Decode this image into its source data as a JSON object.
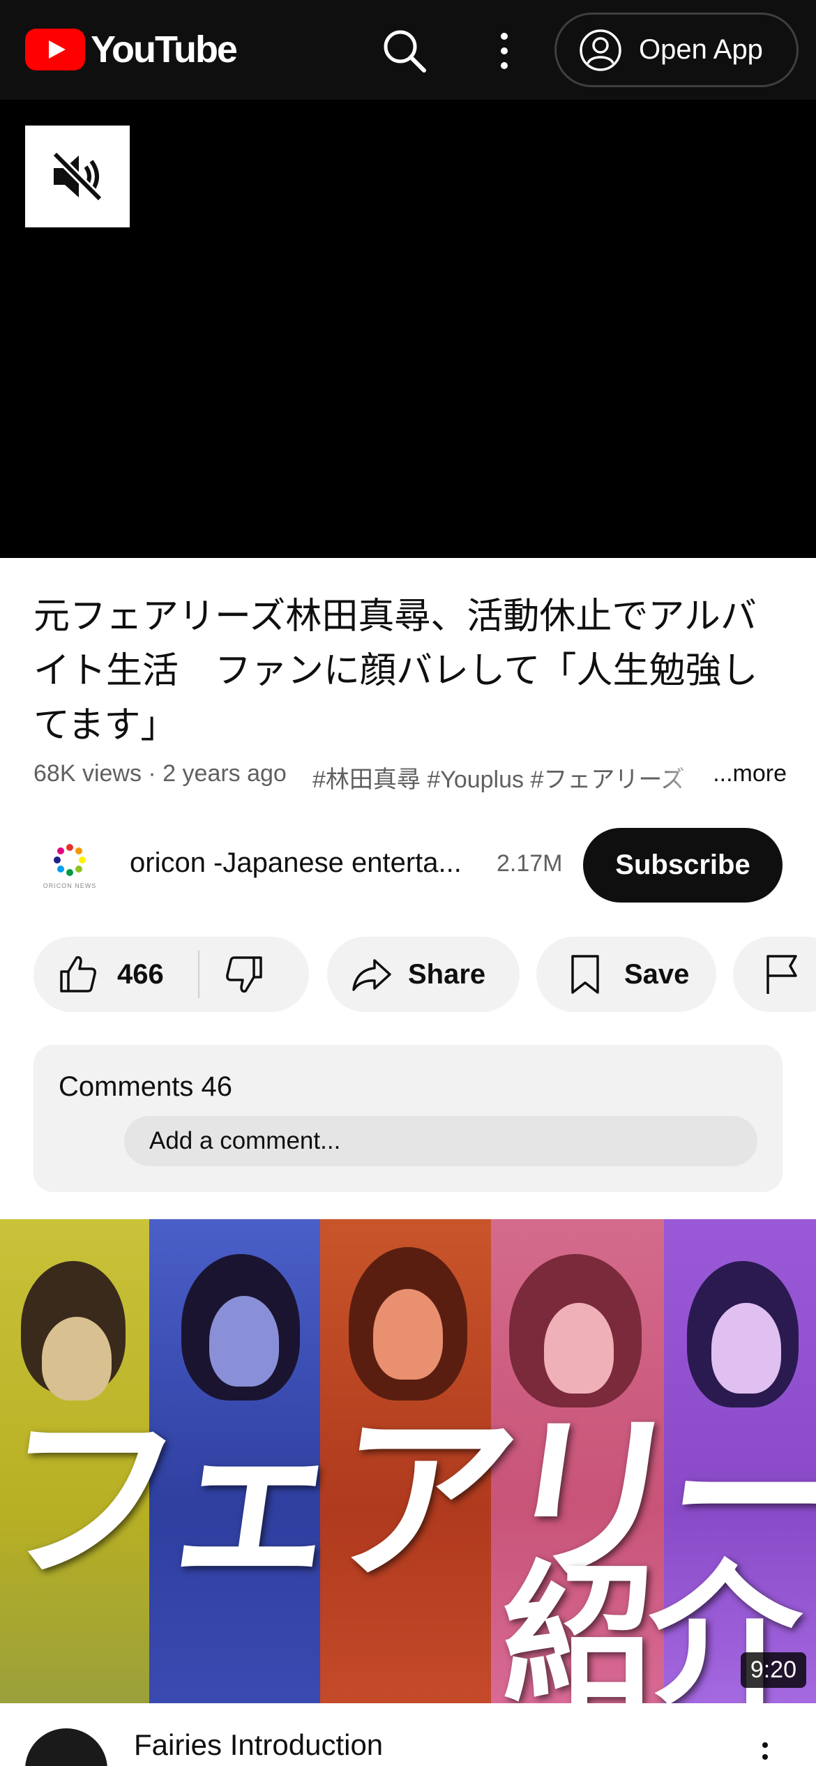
{
  "header": {
    "logo_text": "YouTube",
    "open_app_label": "Open App"
  },
  "player": {
    "muted": true
  },
  "video": {
    "title": "元フェアリーズ林田真尋、活動休止でアルバイト生活　ファンに顔バレして「人生勉強してます」",
    "views_age": "68K views · 2 years ago",
    "hashtags": "#林田真尋 #Youplus #フェアリーズ",
    "more_label": "...more"
  },
  "channel": {
    "name": "oricon -Japanese enterta...",
    "subscribers": "2.17M",
    "subscribe_label": "Subscribe",
    "avatar_text": "ORICON NEWS"
  },
  "actions": {
    "like_count": "466",
    "share_label": "Share",
    "save_label": "Save"
  },
  "comments": {
    "title": "Comments 46",
    "placeholder": "Add a comment..."
  },
  "next_video": {
    "thumbnail_text": "フェアリーズ",
    "thumbnail_subtext": "紹介",
    "duration": "9:20",
    "title": "Fairies Introduction"
  },
  "colors": {
    "brand_red": "#ff0000",
    "header_bg": "#0f0f0f",
    "pill_bg": "#f2f2f2"
  }
}
